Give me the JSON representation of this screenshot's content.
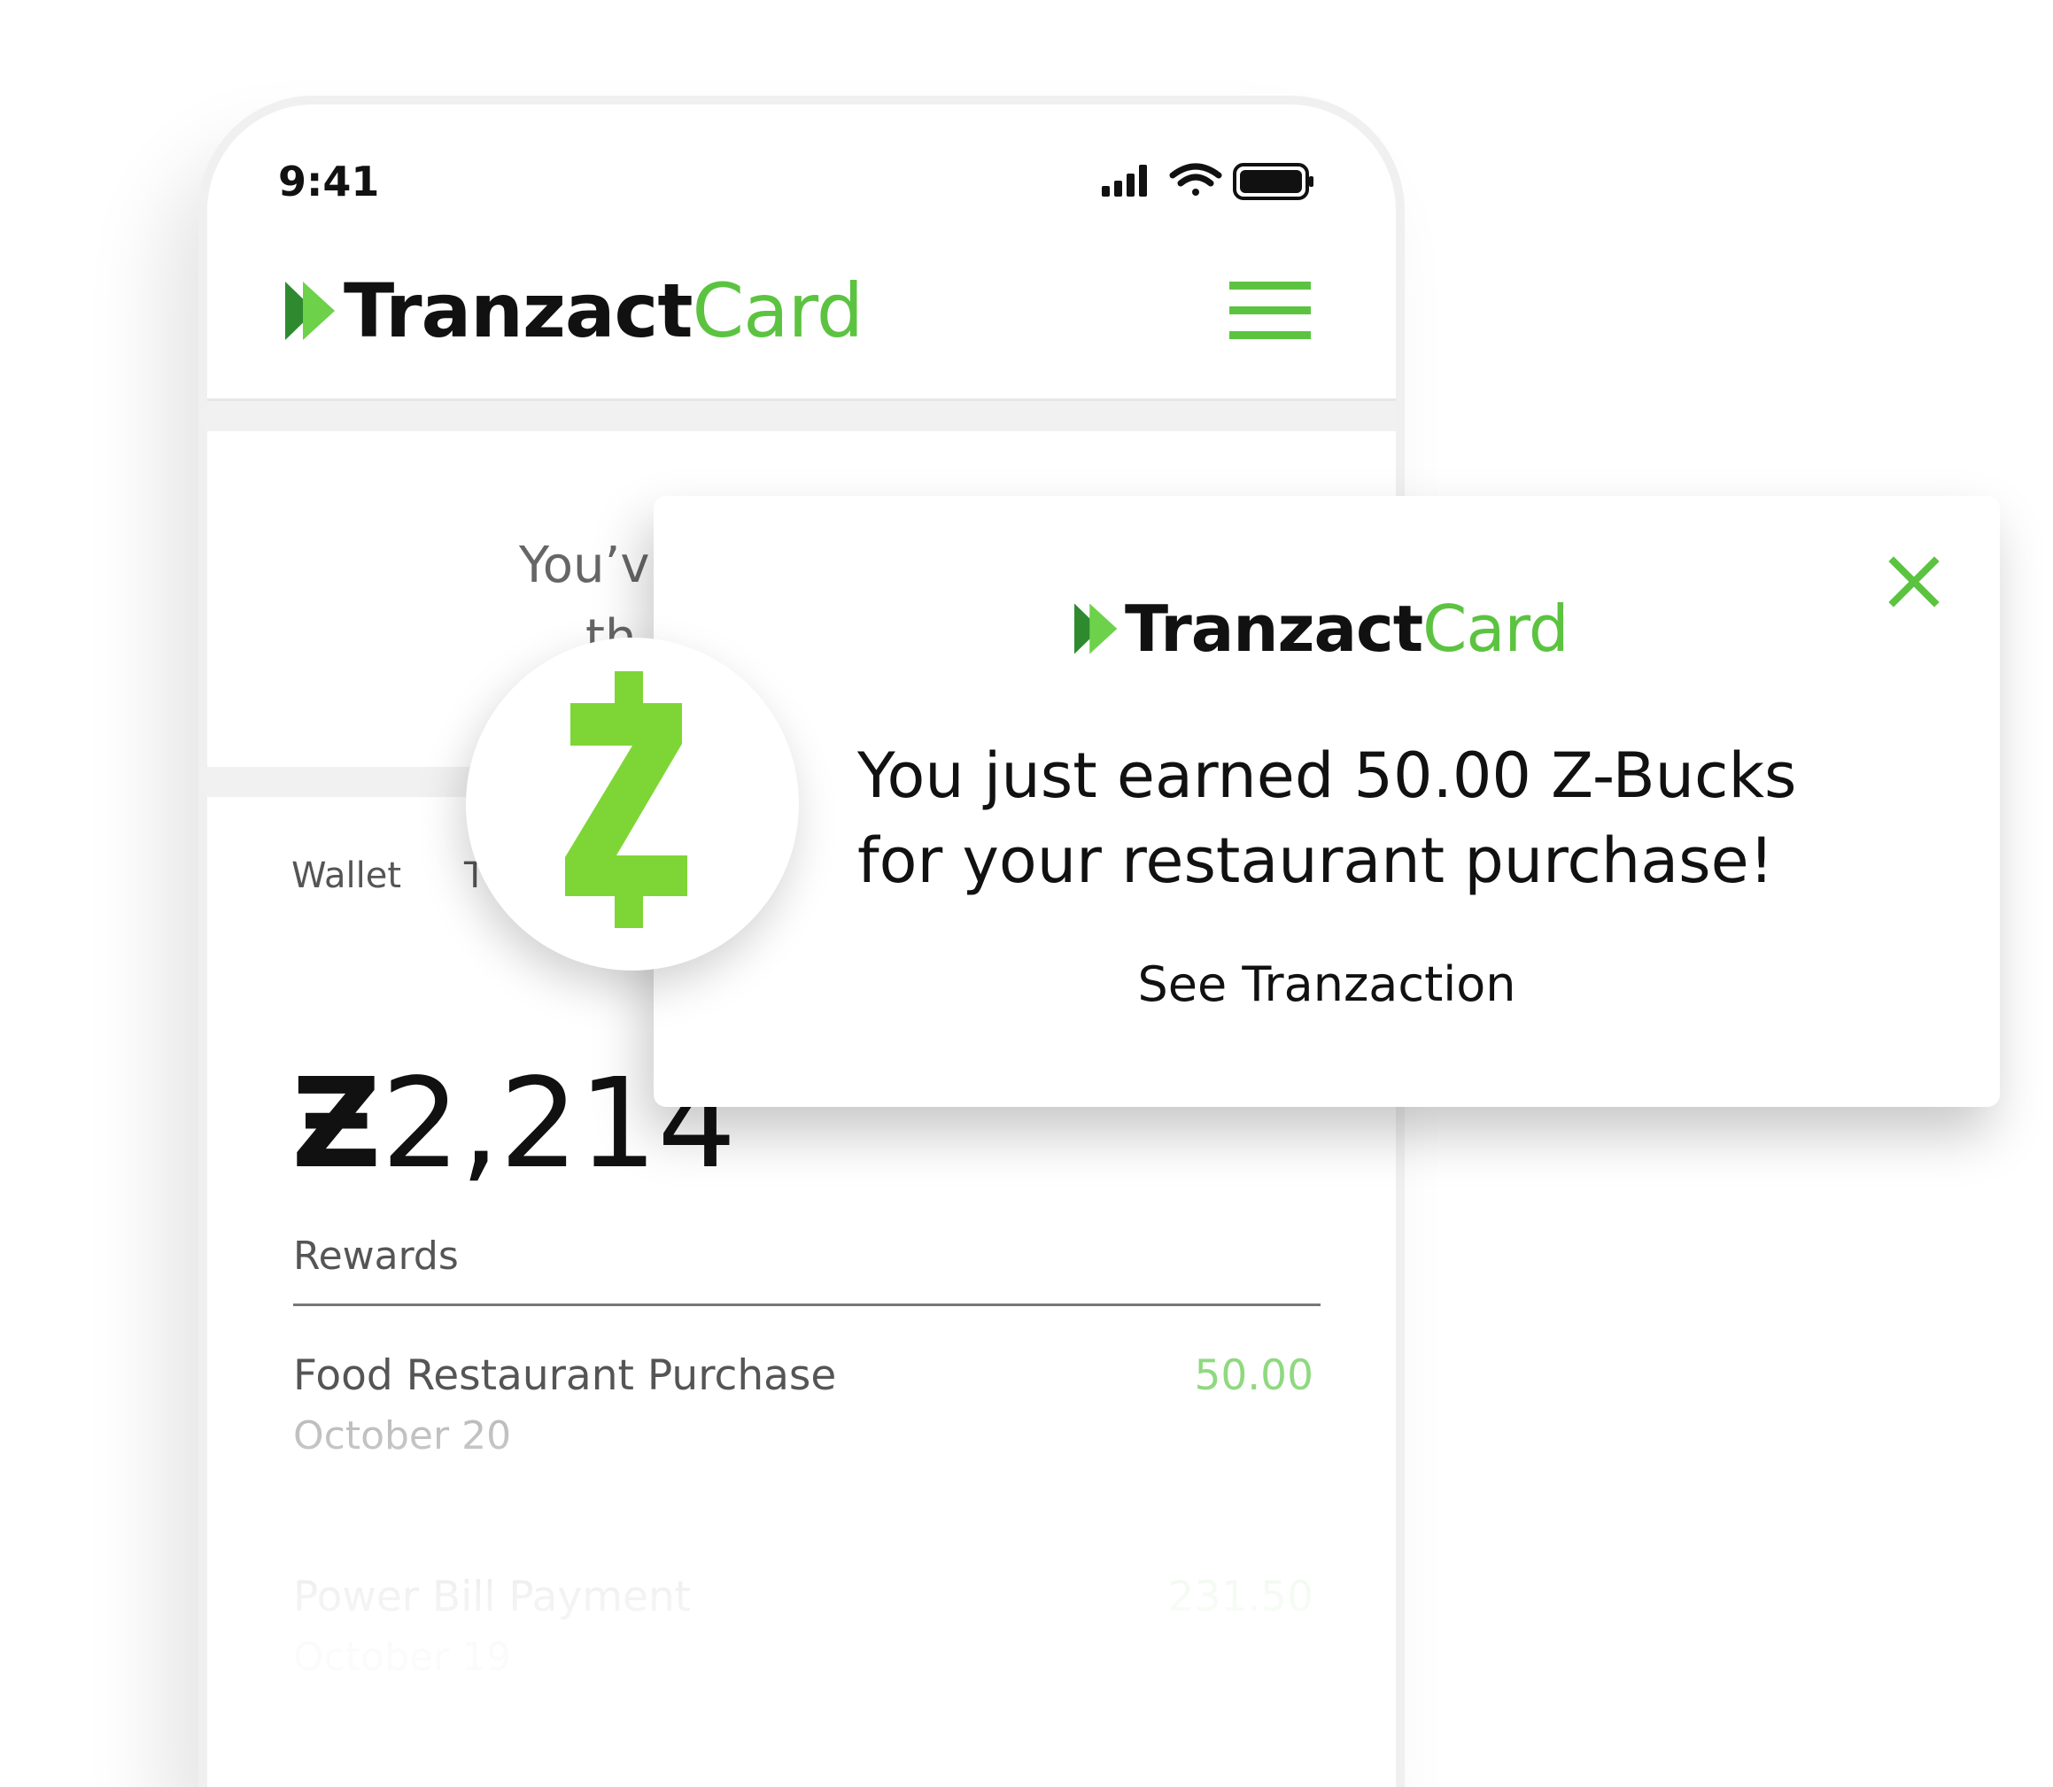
{
  "status_bar": {
    "time": "9:41",
    "icons": [
      "signal-icon",
      "wifi-icon",
      "battery-icon"
    ]
  },
  "header": {
    "brand_main": "Tranzact",
    "brand_accent": "Card",
    "menu_icon": "hamburger-icon"
  },
  "banner": {
    "line1_partial": "You’v",
    "line2_partial": "th"
  },
  "tabs": {
    "wallet": "Wallet",
    "second_partial": "T"
  },
  "balance": {
    "symbol": "Ƶ",
    "amount_partial": "2,214"
  },
  "rewards": {
    "title": "Rewards",
    "transactions": [
      {
        "title": "Food Restaurant Purchase",
        "date": "October 20",
        "amount": "50.00"
      },
      {
        "title": "Power Bill Payment",
        "date": "October 19",
        "amount": "231.50"
      }
    ]
  },
  "notification": {
    "brand_main": "Tranzact",
    "brand_accent": "Card",
    "message_line1": "You just earned 50.00 Z-Bucks",
    "message_line2": "for your restaurant purchase!",
    "link": "See Tranzaction",
    "close_icon": "close-icon"
  },
  "badge": {
    "icon": "z-bucks-icon"
  },
  "colors": {
    "brand_green": "#5cc341",
    "badge_green": "#7ed636",
    "amount_green": "#8fd980",
    "text_dark": "#111111",
    "text_gray": "#555555"
  }
}
